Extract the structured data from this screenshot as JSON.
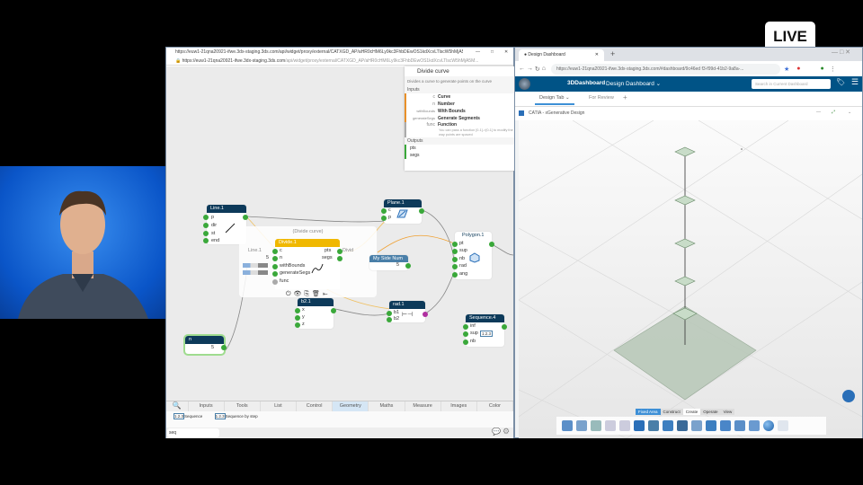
{
  "live_badge": "LIVE",
  "left_window": {
    "title_url": "https://euw1-21qna20921-ifwe.3dx-staging.3ds.com/api/widget/proxy/external/CATXGD_AP/aHR0cHM6Ly9kc3FhbDEwOS1kdXcvLTlscW5hMjA5Mj...",
    "address": "https://euw1-21qna20921-ifwe.3dx-staging.3ds.com",
    "address_path": "/api/widget/proxy/external/CATXGD_AP/aHR0cHM6Ly9kc3FhbDEwOS1kdXcvLTlscW5hMjA5M...",
    "tooltip": {
      "title": "Divide curve",
      "description": "Divides a curve to generate points on the curve",
      "inputs_label": "Inputs",
      "inputs": [
        {
          "port": "c",
          "name": "Curve"
        },
        {
          "port": "n",
          "name": "Number"
        },
        {
          "port": "withBounds",
          "name": "With Bounds"
        },
        {
          "port": "generateSegs",
          "name": "Generate Segments"
        },
        {
          "port": "func",
          "name": "Function",
          "note": "You can pass a function [0-1]->[0-1] to modify the way points are spaced"
        }
      ],
      "outputs_label": "Outputs",
      "outputs": [
        "pts",
        "segs"
      ]
    },
    "nodes": {
      "line": {
        "title": "Line.1",
        "ports": [
          "p",
          "dir",
          "st",
          "end"
        ]
      },
      "plane": {
        "title": "Plane.1",
        "ports": [
          "c",
          "p"
        ]
      },
      "group_caption": "(Divide curve)",
      "divide": {
        "title": "Divide.1",
        "inputs": [
          "c",
          "n",
          "withBounds",
          "generateSegs",
          "func"
        ],
        "outputs": [
          "pts",
          "segs"
        ],
        "c_value": "Line.1",
        "n_value": "5",
        "pts_value": "Divid"
      },
      "side": {
        "title": "My Side Num",
        "value": "5"
      },
      "polygon": {
        "title": "Polygon.1",
        "ports": [
          "pt",
          "sup",
          "nb",
          "rad",
          "ang"
        ]
      },
      "b2": {
        "title": "b2.1",
        "ports": [
          "x",
          "y",
          "z"
        ]
      },
      "rad": {
        "title": "rad.1",
        "ports": [
          "b1",
          "b2"
        ]
      },
      "sequence": {
        "title": "Sequence.4",
        "ports": [
          "inf",
          "sup",
          "nb"
        ],
        "sup_value": "1.2.3"
      },
      "n": {
        "title": "n",
        "value": "5"
      }
    },
    "tabs": [
      "Inputs",
      "Tools",
      "List",
      "Control",
      "Geometry",
      "Maths",
      "Measure",
      "Images",
      "Color"
    ],
    "active_tab": "Geometry",
    "palette": [
      "Sequence",
      "Sequence by step"
    ],
    "search_value": "seq"
  },
  "right_window": {
    "browser_tab": "Design Dashboard",
    "address": "https://euw1-21qna20921-ifwe.3dx-staging.3ds.com/#dashboard/9c46ed f3-f99d-41b2-9a8a-...",
    "brand": "3DDashboard",
    "dashboard": "Design Dashboard",
    "search_placeholder": "Search in Current Dashboard",
    "tabs": [
      "Design Tab",
      "For Review"
    ],
    "widget_title": "CATIA - xGenerative Design",
    "action_tabs": [
      "Fixed Area",
      "Construct",
      "Create",
      "Operate",
      "View"
    ],
    "active_action_tab": "Create",
    "colors": {
      "header": "#005386",
      "accent": "#3d8fd6"
    }
  }
}
